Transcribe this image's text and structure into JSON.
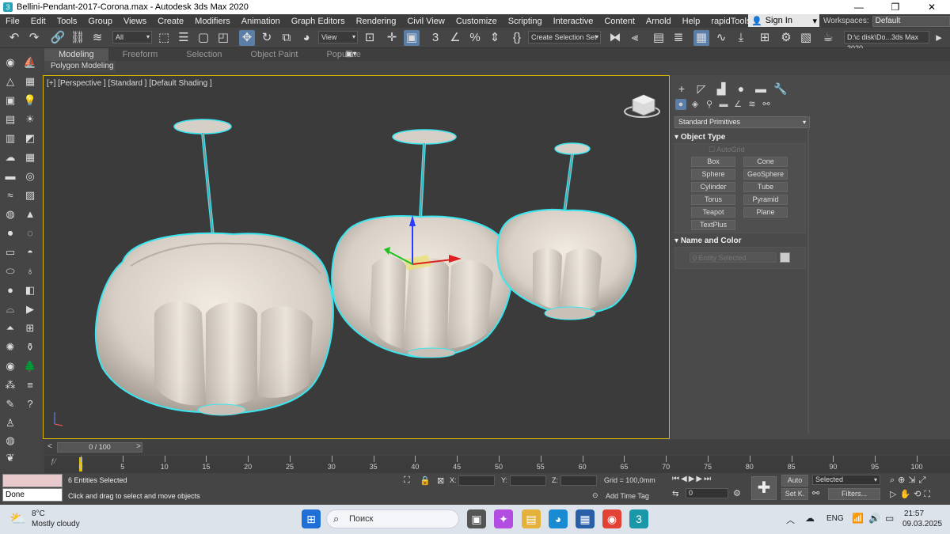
{
  "window": {
    "title": "Bellini-Pendant-2017-Corona.max - Autodesk 3ds Max 2020",
    "minimize": "—",
    "maximize": "❐",
    "close": "✕"
  },
  "menu": [
    "File",
    "Edit",
    "Tools",
    "Group",
    "Views",
    "Create",
    "Modifiers",
    "Animation",
    "Graph Editors",
    "Rendering",
    "Civil View",
    "Customize",
    "Scripting",
    "Interactive",
    "Content",
    "Arnold",
    "Help",
    "rapidTools"
  ],
  "signin": {
    "label": "Sign In"
  },
  "workspaces": {
    "label": "Workspaces:",
    "value": "Default"
  },
  "toolbar": {
    "filter": "All",
    "refcoord": "View",
    "selset": "Create Selection Set",
    "path": "D:\\c disk\\Do...3ds Max 2020"
  },
  "ribbon": {
    "tabs": [
      "Modeling",
      "Freeform",
      "Selection",
      "Object Paint",
      "Populate"
    ],
    "active": "Modeling",
    "sub": "Polygon Modeling"
  },
  "viewport": {
    "label": "[+] [Perspective ] [Standard ] [Default Shading ]"
  },
  "command_panel": {
    "category": "Standard Primitives",
    "object_type": {
      "title": "Object Type",
      "autogrid": "AutoGrid",
      "buttons": [
        "Box",
        "Cone",
        "Sphere",
        "GeoSphere",
        "Cylinder",
        "Tube",
        "Torus",
        "Pyramid",
        "Teapot",
        "Plane",
        "TextPlus"
      ]
    },
    "name_color": {
      "title": "Name and Color",
      "placeholder": "0 Entity Selected"
    }
  },
  "timeline": {
    "frame": "0 / 100",
    "prev": "<",
    "next": ">",
    "ticks": [
      "0",
      "5",
      "10",
      "15",
      "20",
      "25",
      "30",
      "35",
      "40",
      "45",
      "50",
      "55",
      "60",
      "65",
      "70",
      "75",
      "80",
      "85",
      "90",
      "95",
      "100"
    ]
  },
  "status": {
    "listener": "Done",
    "entities": "6 Entities Selected",
    "prompt": "Click and drag to select and move objects",
    "x_label": "X:",
    "y_label": "Y:",
    "z_label": "Z:",
    "grid": "Grid = 100,0mm",
    "add_time_tag": "Add Time Tag",
    "auto": "Auto",
    "setk": "Set K.",
    "selected": "Selected",
    "filters": "Filters...",
    "frame_value": "0"
  },
  "taskbar": {
    "temp": "8°C",
    "weather": "Mostly cloudy",
    "search": "Поиск",
    "lang": "ENG",
    "time": "21:57",
    "date": "09.03.2025"
  },
  "colors": {
    "accent": "#5a7ea8",
    "selection_outline": "#39e6f0",
    "viewport_border": "#d9b600",
    "object": "#d8d0c6"
  }
}
